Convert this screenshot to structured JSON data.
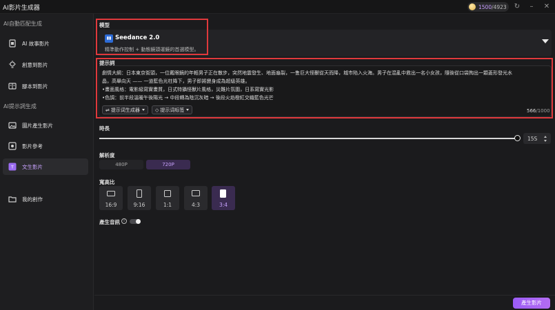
{
  "app": {
    "title": "AI影片生成器",
    "credits_used": "1500",
    "credits_total": "/4923"
  },
  "sidebar": {
    "section1": "AI自動匹配生成",
    "section2": "AI提示詞生成",
    "items": [
      {
        "label": "AI 故事影片",
        "icon": "film-icon"
      },
      {
        "label": "創意到影片",
        "icon": "lightbulb-icon"
      },
      {
        "label": "腳本到影片",
        "icon": "script-icon"
      },
      {
        "label": "圖片產生影片",
        "icon": "image-icon"
      },
      {
        "label": "影片參考",
        "icon": "reference-icon"
      },
      {
        "label": "文生影片",
        "icon": "text-to-video-icon",
        "active": true
      },
      {
        "label": "我的創作",
        "icon": "folder-icon"
      }
    ]
  },
  "model": {
    "label": "模型",
    "name": "Seedance 2.0",
    "description": "精準動作控制 + 動態鏡頭運鏡的首選模型。"
  },
  "prompt": {
    "label": "提示詞",
    "lines": [
      "劇情大綱：日本東京街頭，一位戴眼鏡的年輕男子正在散步，突然地震發生、地面龜裂，一隻巨大怪獸從天而降，城市陷入火海。男子在混亂中救出一名小女孩，隨後從口袋掏出一顆菱形發光水",
      "晶，高舉向天 —— 一道藍色光柱降下，男子即將變身成為超級英雄。",
      "•畫面風格：電影級寫實畫質，日式特攝怪獸片風格，災難片氛圍，日系寫實光影",
      "•色調：前半段溫暖午後陽光 → 中段轉為陰沉灰暗 → 後段火焰橙紅交織藍色光芒"
    ],
    "chip_generator": "提示词生成器",
    "chip_tags": "提示词标签",
    "char_count": "566",
    "char_max": "/1000"
  },
  "duration": {
    "label": "時長",
    "value": "15S",
    "level": 1.0
  },
  "resolution": {
    "label": "解析度",
    "options": [
      "480P",
      "720P"
    ],
    "selected": "720P"
  },
  "aspect_ratio": {
    "label": "寬高比",
    "options": [
      "16:9",
      "9:16",
      "1:1",
      "4:3",
      "3:4"
    ],
    "selected": "3:4"
  },
  "audio": {
    "label": "產生音訊",
    "enabled": false
  },
  "generate_button": "產生影片",
  "colors": {
    "accent": "#9b5cf6",
    "highlight_outline": "#e0393c",
    "background": "#1b1b1d"
  }
}
